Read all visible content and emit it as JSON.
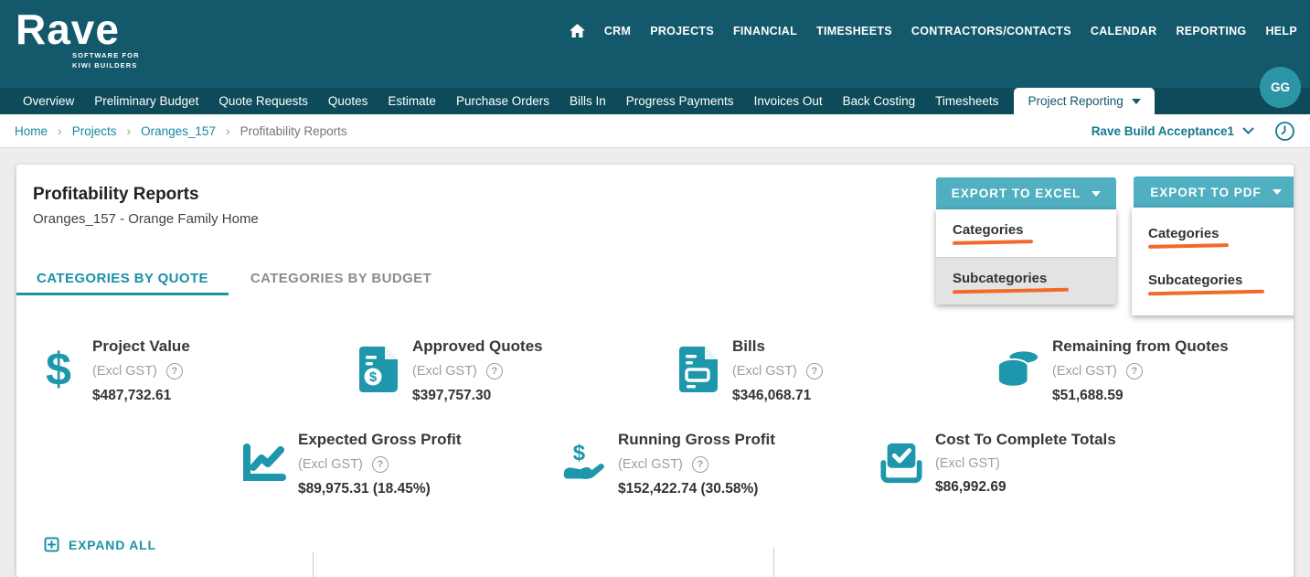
{
  "brand": {
    "name": "Rave",
    "tagline1": "SOFTWARE FOR",
    "tagline2": "KIWI BUILDERS"
  },
  "top_nav": {
    "items": [
      "CRM",
      "PROJECTS",
      "FINANCIAL",
      "TIMESHEETS",
      "CONTRACTORS/CONTACTS",
      "CALENDAR",
      "REPORTING",
      "HELP"
    ]
  },
  "avatar": {
    "initials": "GG"
  },
  "sub_nav": {
    "items": [
      "Overview",
      "Preliminary Budget",
      "Quote Requests",
      "Quotes",
      "Estimate",
      "Purchase Orders",
      "Bills In",
      "Progress Payments",
      "Invoices Out",
      "Back Costing",
      "Timesheets"
    ],
    "active_label": "Project Reporting"
  },
  "breadcrumb": {
    "home": "Home",
    "projects": "Projects",
    "project": "Oranges_157",
    "current": "Profitability Reports",
    "separator": "›"
  },
  "account_switcher": {
    "label": "Rave Build Acceptance1"
  },
  "page": {
    "title": "Profitability Reports",
    "subtitle": "Oranges_157 - Orange Family Home"
  },
  "export_excel": {
    "label": "EXPORT TO EXCEL",
    "items": [
      {
        "label": "Categories"
      },
      {
        "label": "Subcategories"
      }
    ]
  },
  "export_pdf": {
    "label": "EXPORT TO PDF",
    "items": [
      {
        "label": "Categories"
      },
      {
        "label": "Subcategories"
      }
    ]
  },
  "tabs": {
    "quote": "CATEGORIES BY QUOTE",
    "budget": "CATEGORIES BY BUDGET"
  },
  "help": {
    "glyph": "?"
  },
  "stats": {
    "project_value": {
      "title": "Project Value",
      "note": "(Excl GST)",
      "value": "$487,732.61"
    },
    "approved_quotes": {
      "title": "Approved Quotes",
      "note": "(Excl GST)",
      "value": "$397,757.30"
    },
    "bills": {
      "title": "Bills",
      "note": "(Excl GST)",
      "value": "$346,068.71"
    },
    "remaining": {
      "title": "Remaining from Quotes",
      "note": "(Excl GST)",
      "value": "$51,688.59"
    },
    "expected_gp": {
      "title": "Expected Gross Profit",
      "note": "(Excl GST)",
      "value": "$89,975.31 (18.45%)"
    },
    "running_gp": {
      "title": "Running Gross Profit",
      "note": "(Excl GST)",
      "value": "$152,422.74 (30.58%)"
    },
    "cost_to_complete": {
      "title": "Cost To Complete Totals",
      "note": "(Excl GST)",
      "value": "$86,992.69"
    }
  },
  "expand_all": {
    "label": "EXPAND ALL"
  },
  "colors": {
    "header": "#14596B",
    "subnav": "#0D4B5A",
    "accent": "#1787A0",
    "icon_teal": "#1E96AB",
    "button": "#50AFC0",
    "orange_underline": "#F26A2A",
    "tab_active": "#1B91A6"
  }
}
